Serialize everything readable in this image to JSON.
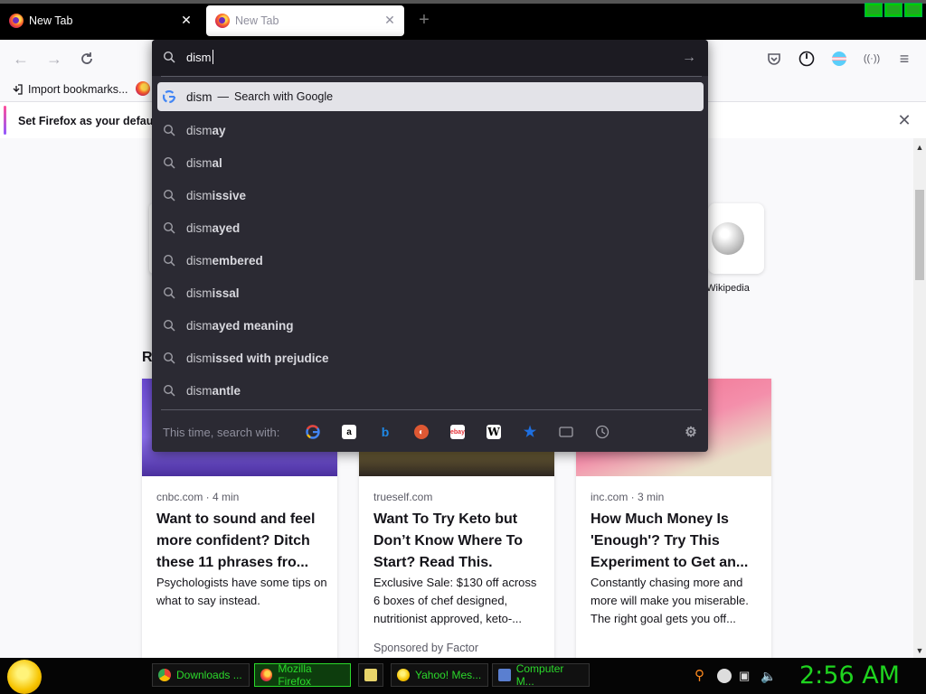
{
  "tabs": [
    {
      "title": "New Tab",
      "active": false
    },
    {
      "title": "New Tab",
      "active": true
    }
  ],
  "navbar": {
    "back": "back-arrow",
    "forward": "forward-arrow",
    "reload": "reload"
  },
  "bookmarks": {
    "import_label": "Import bookmarks..."
  },
  "notification": {
    "text": "Set Firefox as your default"
  },
  "urlbar": {
    "value": "dism"
  },
  "suggestions": {
    "first": {
      "typed": "dism",
      "separator": "—",
      "engine": "Search with Google"
    },
    "items": [
      {
        "prefix": "dism",
        "rest": "ay"
      },
      {
        "prefix": "dism",
        "rest": "al"
      },
      {
        "prefix": "dism",
        "rest": "issive"
      },
      {
        "prefix": "dism",
        "rest": "ayed"
      },
      {
        "prefix": "dism",
        "rest": "embered"
      },
      {
        "prefix": "dism",
        "rest": "issal"
      },
      {
        "prefix": "dism",
        "rest": "ayed meaning"
      },
      {
        "prefix": "dism",
        "rest": "issed with prejudice"
      },
      {
        "prefix": "dism",
        "rest": "antle"
      }
    ]
  },
  "oneoff": {
    "label": "This time, search with:",
    "engines": [
      "Google",
      "Amazon",
      "Bing",
      "DuckDuckGo",
      "eBay",
      "Wikipedia",
      "Bookmarks",
      "Tabs",
      "History"
    ]
  },
  "content": {
    "heading_fragment": "R",
    "top_site_label": "Wikipedia",
    "cards": [
      {
        "source": "cnbc.com · 4 min",
        "title": "Want to sound and feel more confident? Ditch these 11 phrases fro...",
        "desc": "Psychologists have some tips on what to say instead.",
        "sponsor": ""
      },
      {
        "source": "trueself.com",
        "title": "Want To Try Keto but Don’t Know Where To Start? Read This.",
        "desc": "Exclusive Sale: $130 off across 6 boxes of chef designed, nutritionist approved, keto-...",
        "sponsor": "Sponsored by Factor"
      },
      {
        "source": "inc.com · 3 min",
        "title": "How Much Money Is 'Enough'? Try This Experiment to Get an...",
        "desc": "Constantly chasing more and more will make you miserable. The right goal gets you off...",
        "sponsor": ""
      }
    ]
  },
  "taskbar": {
    "buttons": [
      "Downloads ...",
      "Mozilla Firefox",
      "Yahoo! Mes...",
      "Computer M..."
    ],
    "clock": "2:56 AM"
  },
  "colors": {
    "dropdown_bg": "#2b2a33",
    "taskbar_text": "#2bd92b"
  }
}
